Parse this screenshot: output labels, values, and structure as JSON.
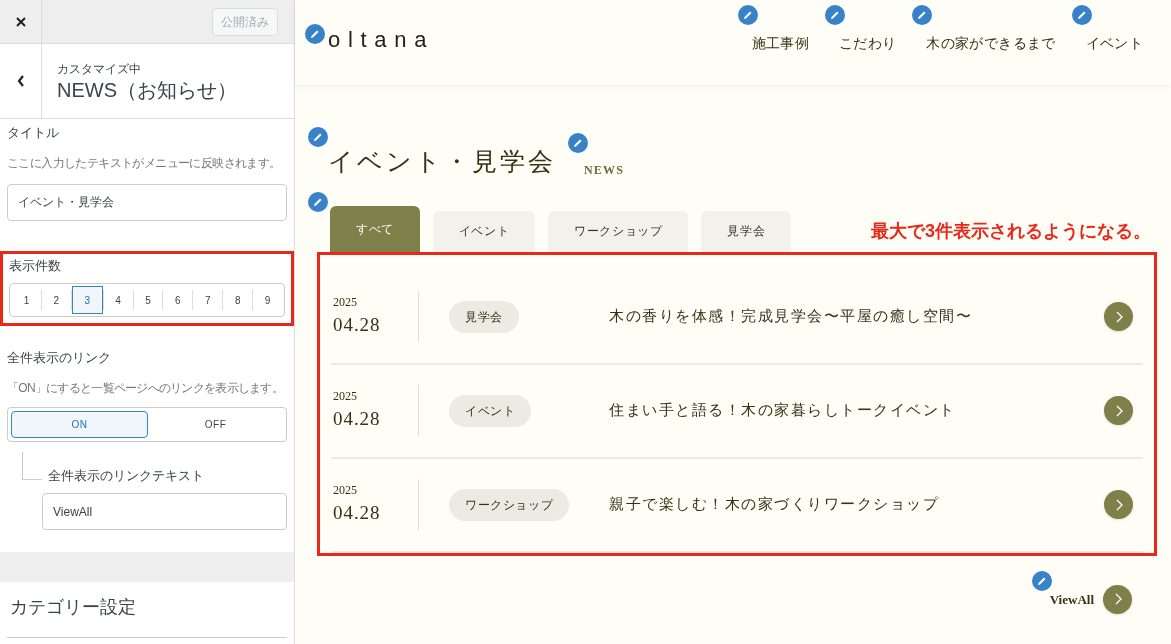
{
  "customizer": {
    "publish_button": {
      "label": "公開済み",
      "disabled": true
    },
    "header": {
      "subtitle": "カスタマイズ中",
      "title": "NEWS（お知らせ）"
    },
    "title_setting": {
      "label": "タイトル",
      "description": "ここに入力したテキストがメニューに反映されます。",
      "value": "イベント・見学会"
    },
    "count_setting": {
      "label": "表示件数",
      "highlighted": true,
      "options": [
        {
          "label": "1",
          "selected": false
        },
        {
          "label": "2",
          "selected": false
        },
        {
          "label": "3",
          "selected": true
        },
        {
          "label": "4",
          "selected": false
        },
        {
          "label": "5",
          "selected": false
        },
        {
          "label": "6",
          "selected": false
        },
        {
          "label": "7",
          "selected": false
        },
        {
          "label": "8",
          "selected": false
        },
        {
          "label": "9",
          "selected": false
        }
      ]
    },
    "link_setting": {
      "label": "全件表示のリンク",
      "description": "「ON」にすると一覧ページへのリンクを表示します。",
      "options": [
        {
          "label": "ON",
          "selected": true
        },
        {
          "label": "OFF",
          "selected": false
        }
      ]
    },
    "link_text_setting": {
      "label": "全件表示のリンクテキスト",
      "value": "ViewAll"
    },
    "category_title": "カテゴリー設定"
  },
  "site": {
    "logo": "oltana",
    "nav": [
      "施工事例",
      "こだわり",
      "木の家ができるまで",
      "イベント"
    ],
    "section_title": "イベント・見学会",
    "section_subtitle": "NEWS",
    "tabs": [
      {
        "label": "すべて",
        "selected": true
      },
      {
        "label": "イベント",
        "selected": false
      },
      {
        "label": "ワークショップ",
        "selected": false
      },
      {
        "label": "見学会",
        "selected": false
      }
    ],
    "annotation": "最大で3件表示されるようになる。",
    "news": [
      {
        "year": "2025",
        "date": "04.28",
        "category": "見学会",
        "title": "木の香りを体感！完成見学会〜平屋の癒し空間〜"
      },
      {
        "year": "2025",
        "date": "04.28",
        "category": "イベント",
        "title": "住まい手と語る！木の家暮らしトークイベント"
      },
      {
        "year": "2025",
        "date": "04.28",
        "category": "ワークショップ",
        "title": "親子で楽しむ！木の家づくりワークショップ"
      }
    ],
    "view_all": "ViewAll"
  }
}
